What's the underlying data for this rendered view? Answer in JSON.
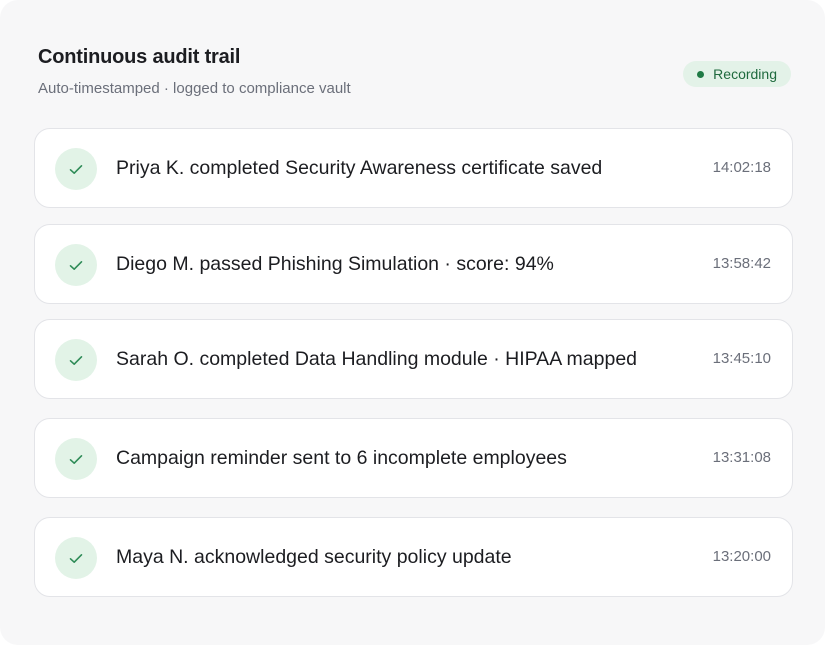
{
  "header": {
    "title": "Continuous audit trail",
    "subtitle": "Auto-timestamped · logged to compliance vault",
    "badge_label": "Recording"
  },
  "colors": {
    "accent_green": "#1f7a45",
    "badge_bg": "#e3f2e8",
    "check_bg": "#e2f3e7"
  },
  "events": [
    {
      "icon": "check-icon",
      "text": "Priya K. completed Security Awareness certificate saved",
      "time": "14:02:18"
    },
    {
      "icon": "check-icon",
      "text": "Diego M. passed Phishing Simulation · score: 94%",
      "time": "13:58:42"
    },
    {
      "icon": "check-icon",
      "text": "Sarah O. completed Data Handling module · HIPAA mapped",
      "time": "13:45:10"
    },
    {
      "icon": "check-icon",
      "text": "Campaign reminder sent to 6 incomplete employees",
      "time": "13:31:08"
    },
    {
      "icon": "check-icon",
      "text": "Maya N. acknowledged security policy update",
      "time": "13:20:00"
    }
  ]
}
